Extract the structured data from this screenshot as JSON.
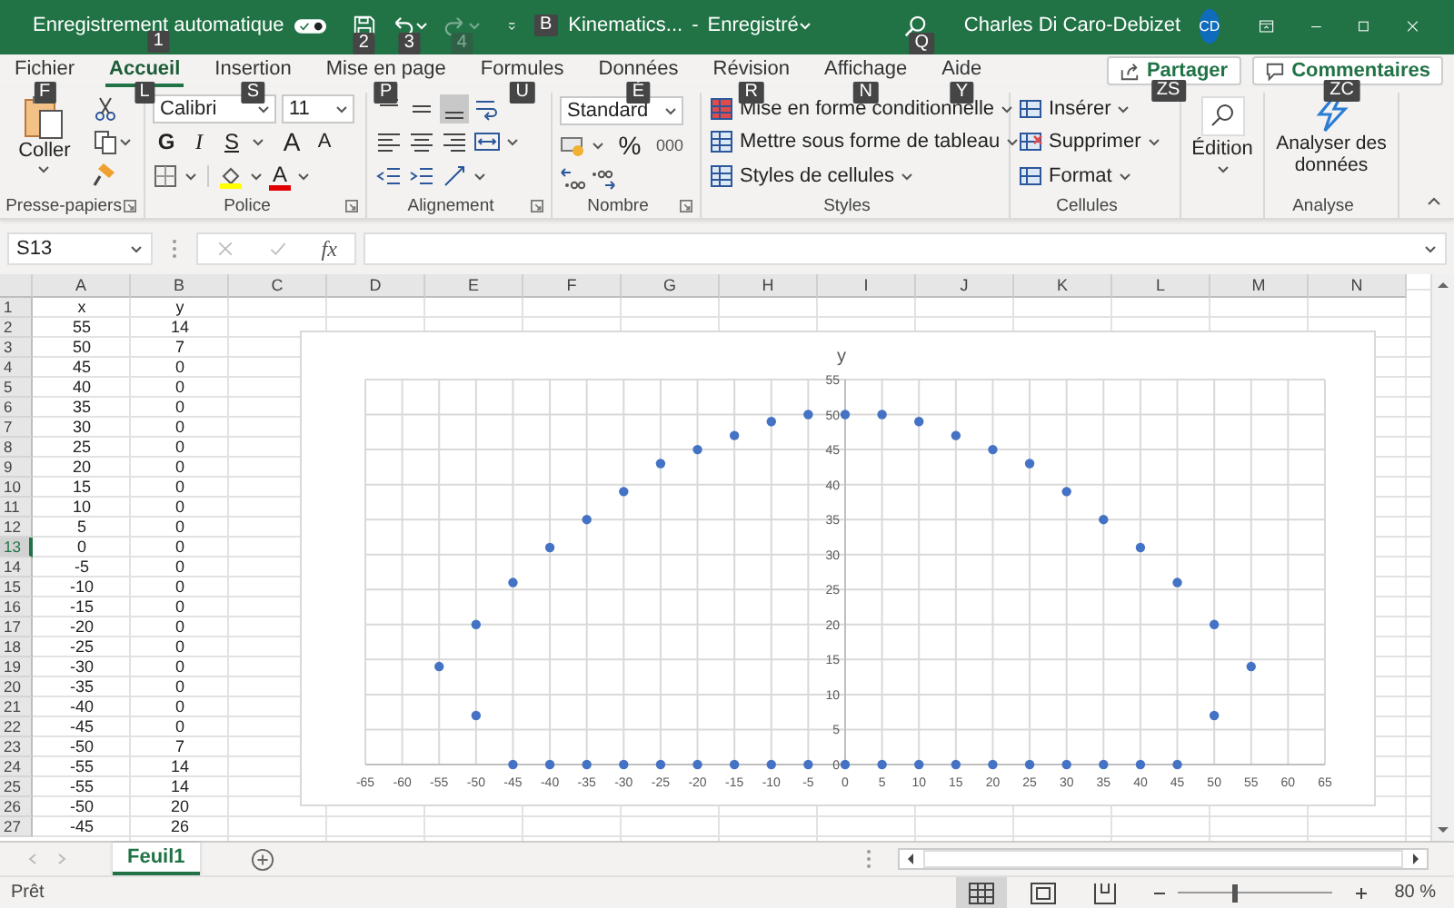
{
  "title_bar": {
    "autosave": {
      "label": "Enregistrement automatique",
      "on": true,
      "keytip": "1"
    },
    "qat": [
      {
        "kind": "save",
        "keytip": "2",
        "disabled": false
      },
      {
        "kind": "undo",
        "keytip": "3",
        "disabled": false
      },
      {
        "kind": "redo",
        "keytip": "4",
        "disabled": true
      }
    ],
    "file_keytip": "B",
    "file_name": "Kinematics...",
    "separator": "-",
    "save_status": "Enregistré",
    "search_keytip": "Q",
    "user": "Charles Di Caro-Debizet",
    "avatar": "CD"
  },
  "tabs": [
    {
      "label": "Fichier",
      "selected": false,
      "keytip": "F"
    },
    {
      "label": "Accueil",
      "selected": true,
      "keytip": "L"
    },
    {
      "label": "Insertion",
      "selected": false,
      "keytip": "S"
    },
    {
      "label": "Mise en page",
      "selected": false,
      "keytip": "P"
    },
    {
      "label": "Formules",
      "selected": false,
      "keytip": "U"
    },
    {
      "label": "Données",
      "selected": false,
      "keytip": "É"
    },
    {
      "label": "Révision",
      "selected": false,
      "keytip": "R"
    },
    {
      "label": "Affichage",
      "selected": false,
      "keytip": "N"
    },
    {
      "label": "Aide",
      "selected": false,
      "keytip": "Y"
    }
  ],
  "share": {
    "label": "Partager",
    "keytip": "ZS"
  },
  "comments": {
    "label": "Commentaires",
    "keytip": "ZC"
  },
  "ribbon": {
    "clipboard": {
      "paste": "Coller",
      "label": "Presse-papiers"
    },
    "font": {
      "name": "Calibri",
      "size": "11",
      "bold": "G",
      "italic": "I",
      "underline": "S",
      "grow": "A",
      "shrink": "A",
      "color_letter": "A",
      "label": "Police"
    },
    "alignment": {
      "vertical": [
        {
          "kind": "top",
          "selected": false
        },
        {
          "kind": "middle",
          "selected": false
        },
        {
          "kind": "bottom",
          "selected": true
        }
      ],
      "label": "Alignement"
    },
    "number": {
      "format": "Standard",
      "percent": "%",
      "thousands": "000",
      "label": "Nombre"
    },
    "styles": {
      "items": [
        {
          "kind": "conditional",
          "label": "Mise en forme conditionnelle"
        },
        {
          "kind": "table",
          "label": "Mettre sous forme de tableau"
        },
        {
          "kind": "cell_styles",
          "label": "Styles de cellules"
        }
      ],
      "label": "Styles"
    },
    "cells": {
      "items": [
        {
          "kind": "insert",
          "label": "Insérer"
        },
        {
          "kind": "delete",
          "label": "Supprimer"
        },
        {
          "kind": "format",
          "label": "Format"
        }
      ],
      "label": "Cellules"
    },
    "editing": {
      "label": "Édition"
    },
    "analysis": {
      "button": "Analyser des données",
      "label": "Analyse"
    }
  },
  "formula_bar": {
    "name_box": "S13",
    "fx": "fx"
  },
  "sheet": {
    "columns": [
      "A",
      "B",
      "C",
      "D",
      "E",
      "F",
      "G",
      "H",
      "I",
      "J",
      "K",
      "L",
      "M",
      "N"
    ],
    "rows": [
      {
        "header": "1",
        "cells": [
          "x",
          "y"
        ],
        "selected": false
      },
      {
        "header": "2",
        "cells": [
          "55",
          "14"
        ],
        "selected": false
      },
      {
        "header": "3",
        "cells": [
          "50",
          "7"
        ],
        "selected": false
      },
      {
        "header": "4",
        "cells": [
          "45",
          "0"
        ],
        "selected": false
      },
      {
        "header": "5",
        "cells": [
          "40",
          "0"
        ],
        "selected": false
      },
      {
        "header": "6",
        "cells": [
          "35",
          "0"
        ],
        "selected": false
      },
      {
        "header": "7",
        "cells": [
          "30",
          "0"
        ],
        "selected": false
      },
      {
        "header": "8",
        "cells": [
          "25",
          "0"
        ],
        "selected": false
      },
      {
        "header": "9",
        "cells": [
          "20",
          "0"
        ],
        "selected": false
      },
      {
        "header": "10",
        "cells": [
          "15",
          "0"
        ],
        "selected": false
      },
      {
        "header": "11",
        "cells": [
          "10",
          "0"
        ],
        "selected": false
      },
      {
        "header": "12",
        "cells": [
          "5",
          "0"
        ],
        "selected": false
      },
      {
        "header": "13",
        "cells": [
          "0",
          "0"
        ],
        "selected": true
      },
      {
        "header": "14",
        "cells": [
          "-5",
          "0"
        ],
        "selected": false
      },
      {
        "header": "15",
        "cells": [
          "-10",
          "0"
        ],
        "selected": false
      },
      {
        "header": "16",
        "cells": [
          "-15",
          "0"
        ],
        "selected": false
      },
      {
        "header": "17",
        "cells": [
          "-20",
          "0"
        ],
        "selected": false
      },
      {
        "header": "18",
        "cells": [
          "-25",
          "0"
        ],
        "selected": false
      },
      {
        "header": "19",
        "cells": [
          "-30",
          "0"
        ],
        "selected": false
      },
      {
        "header": "20",
        "cells": [
          "-35",
          "0"
        ],
        "selected": false
      },
      {
        "header": "21",
        "cells": [
          "-40",
          "0"
        ],
        "selected": false
      },
      {
        "header": "22",
        "cells": [
          "-45",
          "0"
        ],
        "selected": false
      },
      {
        "header": "23",
        "cells": [
          "-50",
          "7"
        ],
        "selected": false
      },
      {
        "header": "24",
        "cells": [
          "-55",
          "14"
        ],
        "selected": false
      },
      {
        "header": "25",
        "cells": [
          "-55",
          "14"
        ],
        "selected": false
      },
      {
        "header": "26",
        "cells": [
          "-50",
          "20"
        ],
        "selected": false
      },
      {
        "header": "27",
        "cells": [
          "-45",
          "26"
        ],
        "selected": false
      }
    ]
  },
  "chart": {
    "chart_data": {
      "type": "scatter",
      "title": "y",
      "x": [
        -55,
        -50,
        -45,
        -40,
        -35,
        -30,
        -25,
        -20,
        -15,
        -10,
        -5,
        0,
        5,
        10,
        15,
        20,
        25,
        30,
        35,
        40,
        45,
        50,
        55,
        -50,
        -45,
        -40,
        -35,
        -30,
        -25,
        -20,
        -15,
        -10,
        -5,
        0,
        5,
        10,
        15,
        20,
        25,
        30,
        35,
        40,
        45,
        50
      ],
      "series": [
        {
          "color": "#4472c4",
          "values": [
            14,
            20,
            26,
            31,
            35,
            39,
            43,
            45,
            47,
            49,
            50,
            50,
            50,
            49,
            47,
            45,
            43,
            39,
            35,
            31,
            26,
            20,
            14,
            7,
            0,
            0,
            0,
            0,
            0,
            0,
            0,
            0,
            0,
            0,
            0,
            0,
            0,
            0,
            0,
            0,
            0,
            0,
            0,
            7
          ]
        }
      ],
      "xlim": [
        -65,
        65
      ],
      "ylim": [
        0,
        55
      ],
      "xticks": [
        -65,
        -60,
        -55,
        -50,
        -45,
        -40,
        -35,
        -30,
        -25,
        -20,
        -15,
        -10,
        -5,
        0,
        5,
        10,
        15,
        20,
        25,
        30,
        35,
        40,
        45,
        50,
        55,
        60,
        65
      ],
      "yticks": [
        0,
        5,
        10,
        15,
        20,
        25,
        30,
        35,
        40,
        45,
        50,
        55
      ],
      "grid": true
    }
  },
  "sheet_tabs": [
    {
      "label": "Feuil1",
      "selected": true
    }
  ],
  "status_bar": {
    "status": "Prêt",
    "views": [
      {
        "kind": "normal",
        "selected": true
      },
      {
        "kind": "page_layout",
        "selected": false
      },
      {
        "kind": "page_break",
        "selected": false
      }
    ],
    "zoom": {
      "level": 0.36,
      "label": "80 %"
    }
  }
}
